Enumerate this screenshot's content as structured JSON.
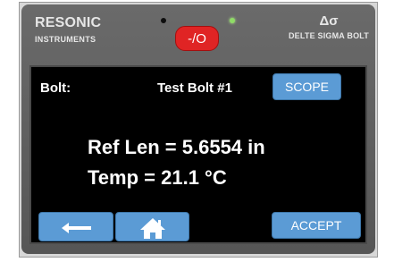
{
  "header": {
    "brand_name": "RESONIC",
    "brand_sub": "INSTRUMENTS",
    "right_mark": "Δσ",
    "right_sub": "DELTE SIGMA BOLT",
    "power_label": "-/O"
  },
  "screen": {
    "bolt_label": "Bolt:",
    "bolt_name": "Test Bolt  #1",
    "scope_label": "SCOPE",
    "ref_len": "Ref Len = 5.6554 in",
    "temp": "Temp = 21.1 °C",
    "accept_label": "ACCEPT"
  },
  "icons": {
    "back": "arrow-left-icon",
    "home": "home-icon"
  },
  "colors": {
    "screen_bg": "#000000",
    "button_blue": "#5b9bd5",
    "power_red": "#e02424",
    "bezel": "#5f5f5f",
    "led_green": "#8fdc66"
  }
}
